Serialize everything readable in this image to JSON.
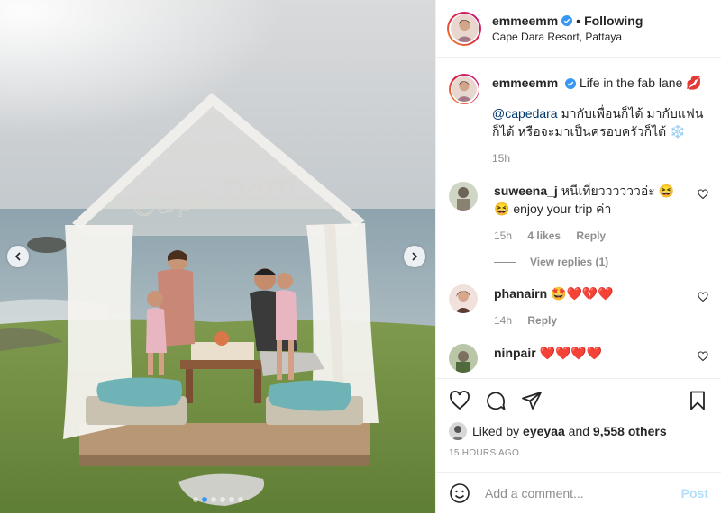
{
  "post": {
    "username": "emmeemm",
    "follow_label": "Following",
    "separator": "•",
    "location": "Cape Dara Resort, Pattaya"
  },
  "caption": {
    "username": "emmeemm",
    "text": "Life in the fab lane 💋",
    "mention": "@capedara",
    "thai_line1": " มากับเพื่อนก็ได้ มากับแฟน",
    "thai_line2": "ก็ได้ หรือจะมาเป็นครอบครัวก็ได้ ❄️",
    "time": "15h"
  },
  "comments": [
    {
      "username": "suweena_j",
      "text_line1": "หนีเที่ยววววววอ่ะ 😆",
      "text_line2": "😆 enjoy your trip ค่า",
      "time": "15h",
      "likes": "4 likes",
      "reply": "Reply"
    },
    {
      "username": "phanairn",
      "text": "🤩❤️💔❤️",
      "time": "14h",
      "reply": "Reply"
    },
    {
      "username": "ninpair",
      "text": "❤️❤️❤️❤️"
    }
  ],
  "view_replies": "View replies (1)",
  "likes": {
    "prefix": "Liked by",
    "user": "eyeyaa",
    "and": "and",
    "count": "9,558 others"
  },
  "timestamp": "15 HOURS AGO",
  "add_comment": {
    "placeholder": "Add a comment...",
    "post_label": "Post"
  },
  "photo_overlay_text": "Cape Dara",
  "colors": {
    "verified": "#3897f0",
    "link": "#00376b",
    "post_disabled": "#b2dffc",
    "meta": "#8e8e8e"
  },
  "icons": [
    "verified-icon",
    "heart-icon",
    "comment-icon",
    "share-icon",
    "bookmark-icon",
    "emoji-icon",
    "chevron-left-icon",
    "chevron-right-icon"
  ]
}
